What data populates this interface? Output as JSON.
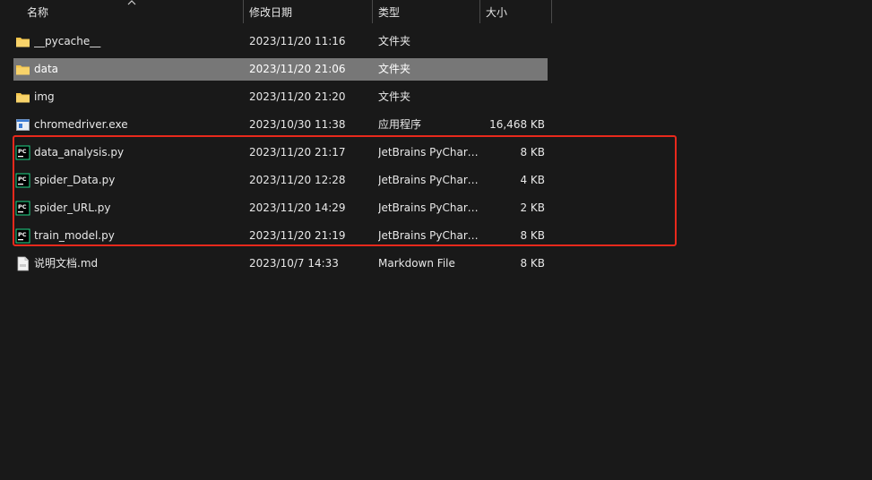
{
  "columns": {
    "name": "名称",
    "date": "修改日期",
    "type": "类型",
    "size": "大小"
  },
  "files": [
    {
      "name": "__pycache__",
      "date": "2023/11/20 11:16",
      "type": "文件夹",
      "size": "",
      "icon": "folder-icon"
    },
    {
      "name": "data",
      "date": "2023/11/20 21:06",
      "type": "文件夹",
      "size": "",
      "icon": "folder-icon",
      "selected": true
    },
    {
      "name": "img",
      "date": "2023/11/20 21:20",
      "type": "文件夹",
      "size": "",
      "icon": "folder-icon"
    },
    {
      "name": "chromedriver.exe",
      "date": "2023/10/30 11:38",
      "type": "应用程序",
      "size": "16,468 KB",
      "icon": "exe-icon"
    },
    {
      "name": "data_analysis.py",
      "date": "2023/11/20 21:17",
      "type": "JetBrains PyCharm...",
      "size": "8 KB",
      "icon": "pycharm-file-icon"
    },
    {
      "name": "spider_Data.py",
      "date": "2023/11/20 12:28",
      "type": "JetBrains PyCharm...",
      "size": "4 KB",
      "icon": "pycharm-file-icon"
    },
    {
      "name": "spider_URL.py",
      "date": "2023/11/20 14:29",
      "type": "JetBrains PyCharm...",
      "size": "2 KB",
      "icon": "pycharm-file-icon"
    },
    {
      "name": "train_model.py",
      "date": "2023/11/20 21:19",
      "type": "JetBrains PyCharm...",
      "size": "8 KB",
      "icon": "pycharm-file-icon"
    },
    {
      "name": "说明文档.md",
      "date": "2023/10/7 14:33",
      "type": "Markdown File",
      "size": "8 KB",
      "icon": "markdown-file-icon"
    }
  ],
  "colors": {
    "background": "#191919",
    "selected_row": "#777777",
    "highlight_border": "#e8291c",
    "folder": "#f4c54b",
    "pycharm_green": "#21d789"
  }
}
